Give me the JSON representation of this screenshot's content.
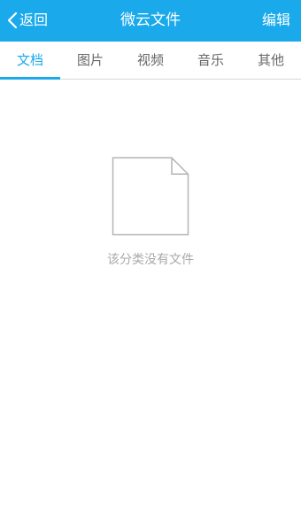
{
  "header": {
    "back_label": "返回",
    "title": "微云文件",
    "edit_label": "编辑",
    "back_icon": "chevron-left-icon",
    "background_color": "#1aaaeb"
  },
  "tabs": [
    {
      "label": "文档",
      "active": true
    },
    {
      "label": "图片",
      "active": false
    },
    {
      "label": "视频",
      "active": false
    },
    {
      "label": "音乐",
      "active": false
    },
    {
      "label": "其他",
      "active": false
    }
  ],
  "empty_state": {
    "icon": "blank-document-icon",
    "message": "该分类没有文件"
  },
  "colors": {
    "accent": "#1aaaeb",
    "tab_text": "#666666",
    "empty_text": "#a9a9a9"
  }
}
